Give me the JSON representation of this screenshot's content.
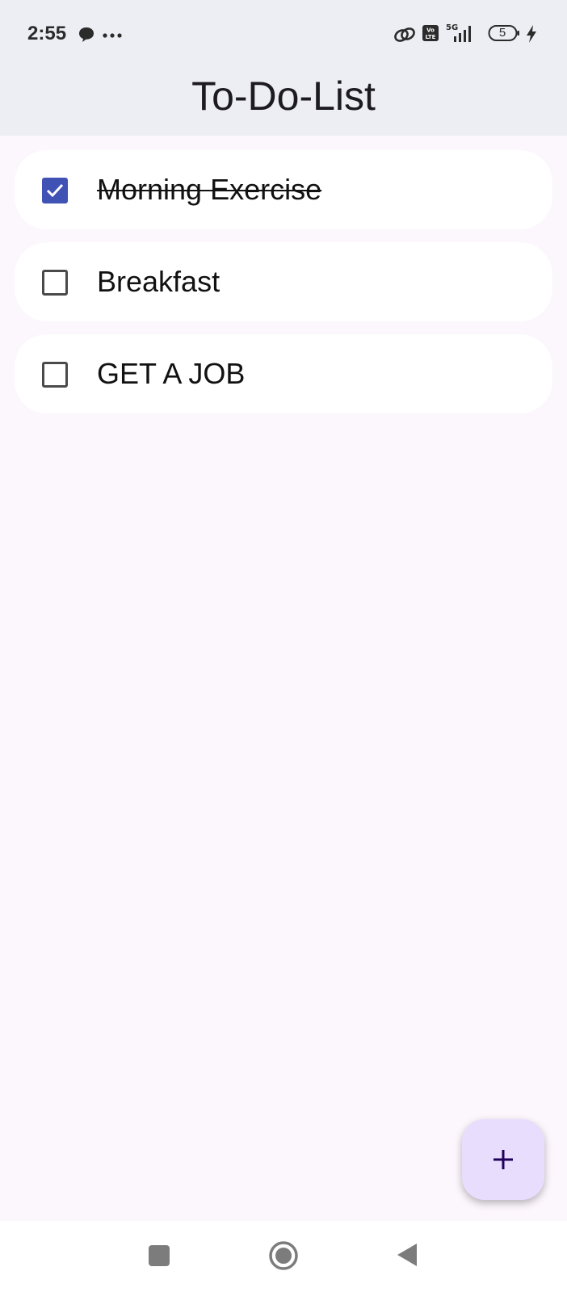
{
  "status_bar": {
    "time": "2:55",
    "network": "5G",
    "battery_level": "5",
    "icons": [
      "chat-icon",
      "more-icon",
      "link-icon",
      "volte-icon",
      "signal-icon",
      "battery-icon",
      "charging-icon"
    ]
  },
  "app_bar": {
    "title": "To-Do-List"
  },
  "tasks": [
    {
      "label": "Morning Exercise",
      "checked": true
    },
    {
      "label": "Breakfast",
      "checked": false
    },
    {
      "label": "GET A JOB",
      "checked": false
    }
  ],
  "fab": {
    "icon": "plus-icon"
  },
  "nav_bar": {
    "icons": [
      "recents-icon",
      "home-icon",
      "back-icon"
    ]
  },
  "colors": {
    "accent": "#4053b4",
    "fab_bg": "#e9ddfd",
    "background": "#fcf6fd",
    "app_bar_bg": "#eceef3"
  }
}
